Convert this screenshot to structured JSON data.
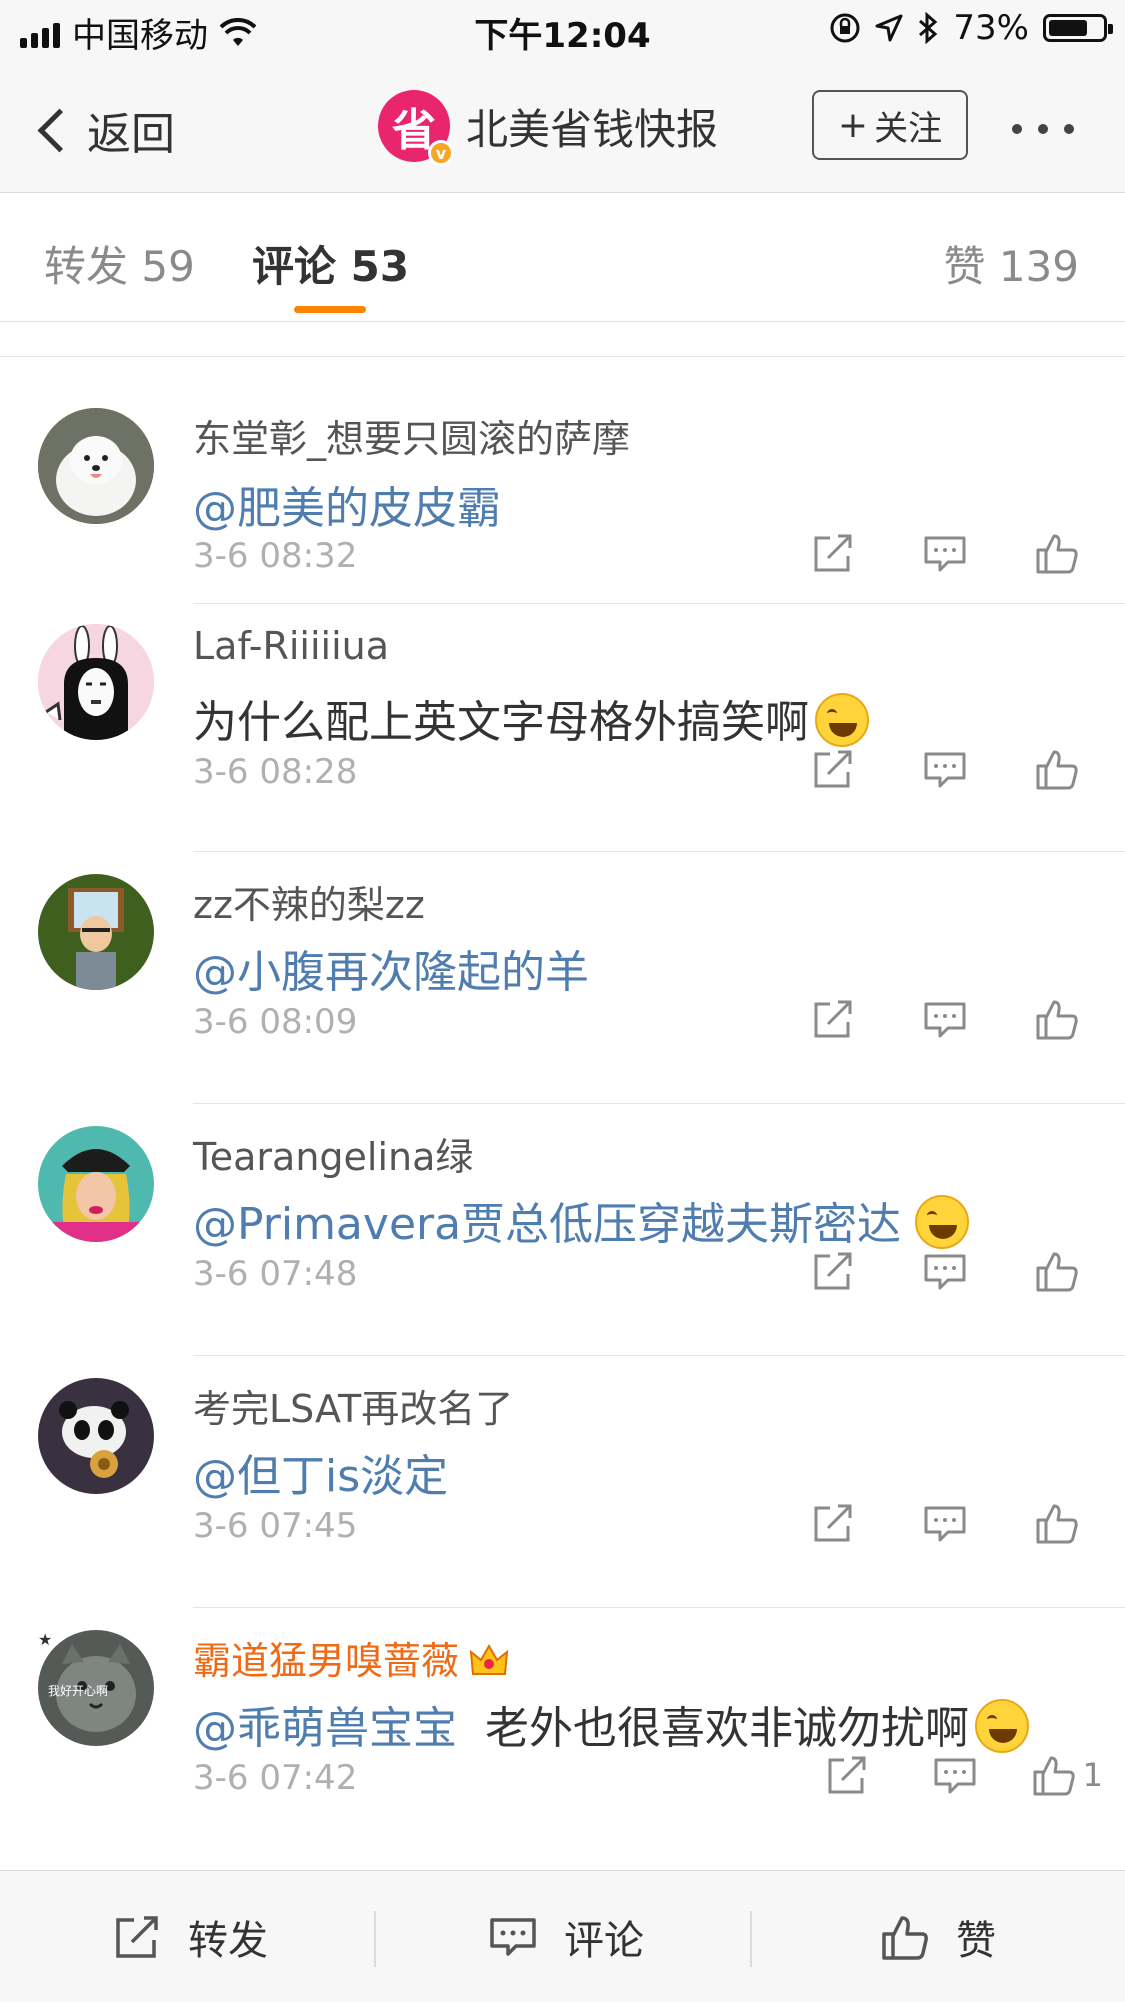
{
  "status_bar": {
    "carrier": "中国移动",
    "time": "下午12:04",
    "battery": "73%",
    "battery_level": 0.73
  },
  "nav": {
    "back_label": "返回",
    "logo_text": "省",
    "title": "北美省钱快报",
    "follow_label": "关注"
  },
  "tabs": {
    "repost": "转发 59",
    "comment": "评论 53",
    "like": "赞 139"
  },
  "comments": [
    {
      "username": "东堂彰_想要只圆滚的萨摩",
      "mention": "@肥美的皮皮霸",
      "text": "",
      "time": "3-6 08:32",
      "avatar_icon": "samoyed-dog-avatar"
    },
    {
      "username": "Laf-Riiiiiua",
      "mention": "",
      "text": "为什么配上英文字母格外搞笑啊",
      "time": "3-6 08:28",
      "avatar_icon": "bunny-noface-avatar"
    },
    {
      "username": "zz不辣的梨zz",
      "mention": "@小腹再次隆起的羊",
      "text": "",
      "time": "3-6 08:09",
      "avatar_icon": "cartoon-man-avatar"
    },
    {
      "username": "Tearangelina绿",
      "mention": "@Primavera贾总低压穿越夫斯密达",
      "text": "",
      "time": "3-6 07:48",
      "avatar_icon": "pinup-woman-avatar"
    },
    {
      "username": "考完LSAT再改名了",
      "mention": "@但丁is淡定",
      "text": "",
      "time": "3-6 07:45",
      "avatar_icon": "panda-avatar"
    },
    {
      "username": "霸道猛男嗅蔷薇",
      "mention": "@乖萌兽宝宝",
      "text": "老外也很喜欢非诚勿扰啊",
      "time": "3-6 07:42",
      "avatar_icon": "cat-avatar",
      "avatar_caption": "我好开心啊",
      "like_count": "1"
    }
  ],
  "bottom_bar": {
    "repost": "转发",
    "comment": "评论",
    "like": "赞"
  },
  "colors": {
    "accent": "#ff8200",
    "mention": "#507daf",
    "vip_name": "#f06a16",
    "logo": "#e8256d"
  }
}
